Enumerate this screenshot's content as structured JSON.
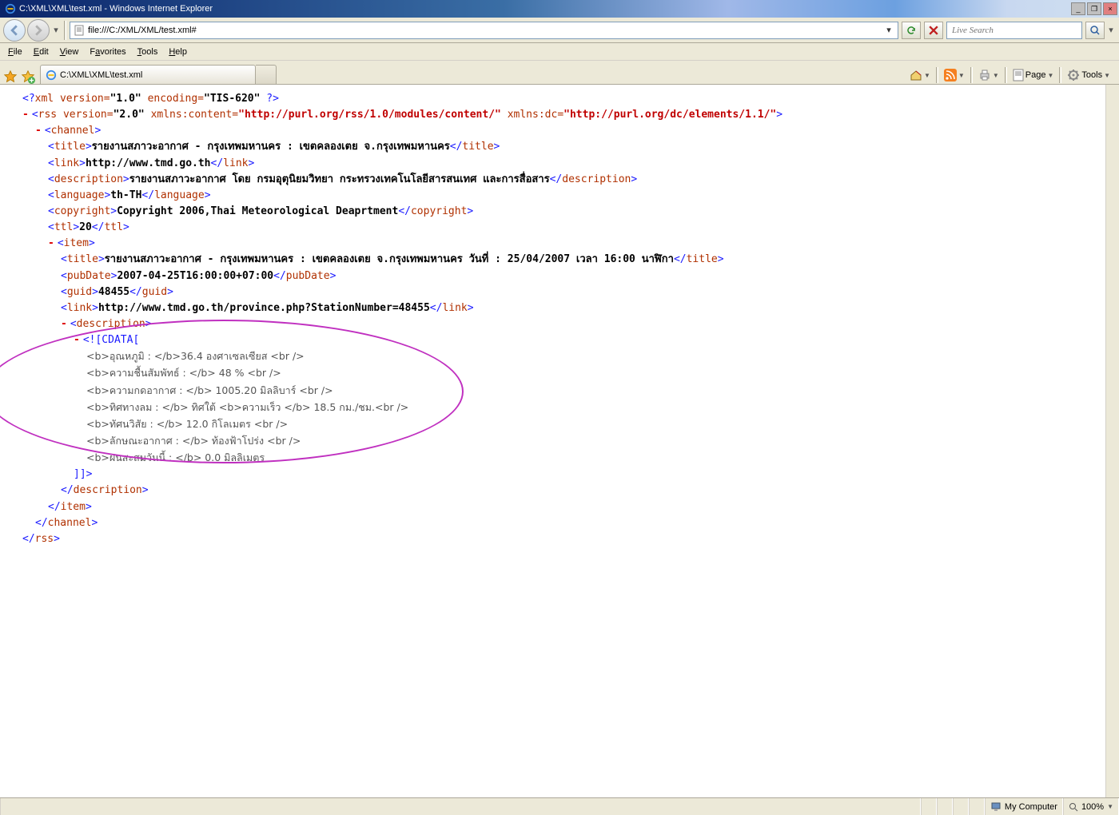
{
  "window": {
    "title": "C:\\XML\\XML\\test.xml - Windows Internet Explorer",
    "min": "_",
    "restore": "❐",
    "close": "×"
  },
  "address": {
    "url": "file:///C:/XML/XML/test.xml#",
    "refresh": "↻",
    "stop": "✕"
  },
  "search": {
    "placeholder": "Live Search"
  },
  "menu": {
    "file": "File",
    "edit": "Edit",
    "view": "View",
    "favorites": "Favorites",
    "tools": "Tools",
    "help": "Help"
  },
  "tab": {
    "label": "C:\\XML\\XML\\test.xml"
  },
  "toolbar": {
    "page": "Page",
    "tools": "Tools"
  },
  "xml": {
    "decl_version_attr": "version=",
    "decl_version_val": "\"1.0\"",
    "decl_enc_attr": "encoding=",
    "decl_enc_val": "\"TIS-620\"",
    "rss_open": "rss",
    "rss_version_attr": "version=",
    "rss_version_val": "\"2.0\"",
    "xmlns_content_attr": "xmlns:content=",
    "xmlns_content_val": "\"http://purl.org/rss/1.0/modules/content/\"",
    "xmlns_dc_attr": "xmlns:dc=",
    "xmlns_dc_val": "\"http://purl.org/dc/elements/1.1/\"",
    "channel": "channel",
    "title_tag": "title",
    "title_val": "รายงานสภาวะอากาศ - กรุงเทพมหานคร : เขตคลองเตย จ.กรุงเทพมหานคร",
    "link_tag": "link",
    "link_val": "http://www.tmd.go.th",
    "desc_tag": "description",
    "desc_val": "รายงานสภาวะอากาศ โดย กรมอุตุนิยมวิทยา กระทรวงเทคโนโลยีสารสนเทศ และการสื่อสาร",
    "lang_tag": "language",
    "lang_val": "th-TH",
    "copy_tag": "copyright",
    "copy_val": "Copyright 2006,Thai Meteorological Deaprtment",
    "ttl_tag": "ttl",
    "ttl_val": "20",
    "item": "item",
    "item_title_val": "รายงานสภาวะอากาศ - กรุงเทพมหานคร : เขตคลองเตย จ.กรุงเทพมหานคร วันที่ : 25/04/2007 เวลา 16:00 นาฬิกา",
    "pubdate_tag": "pubDate",
    "pubdate_val": "2007-04-25T16:00:00+07:00",
    "guid_tag": "guid",
    "guid_val": "48455",
    "item_link_val": "http://www.tmd.go.th/province.php?StationNumber=48455",
    "cdata_open": "<![CDATA[",
    "cdata_close": "]]>",
    "cdata_l1": "<b>อุณหภูมิ : </b>36.4 องศาเซลเซียส <br />",
    "cdata_l2": "<b>ความชื้นสัมพัทธ์ : </b> 48 % <br />",
    "cdata_l3": "<b>ความกดอากาศ : </b> 1005.20 มิลลิบาร์ <br />",
    "cdata_l4": "<b>ทิศทางลม : </b> ทิศใต้ <b>ความเร็ว </b> 18.5 กม./ชม.<br />",
    "cdata_l5": "<b>ทัศนวิสัย : </b> 12.0 กิโลเมตร <br />",
    "cdata_l6": "<b>ลักษณะอากาศ : </b> ท้องฟ้าโปร่ง <br />",
    "cdata_l7": "<b>ฝนสะสมวันนี้ : </b> 0.0 มิลลิเมตร"
  },
  "status": {
    "zone": "My Computer",
    "zoom": "100%"
  }
}
